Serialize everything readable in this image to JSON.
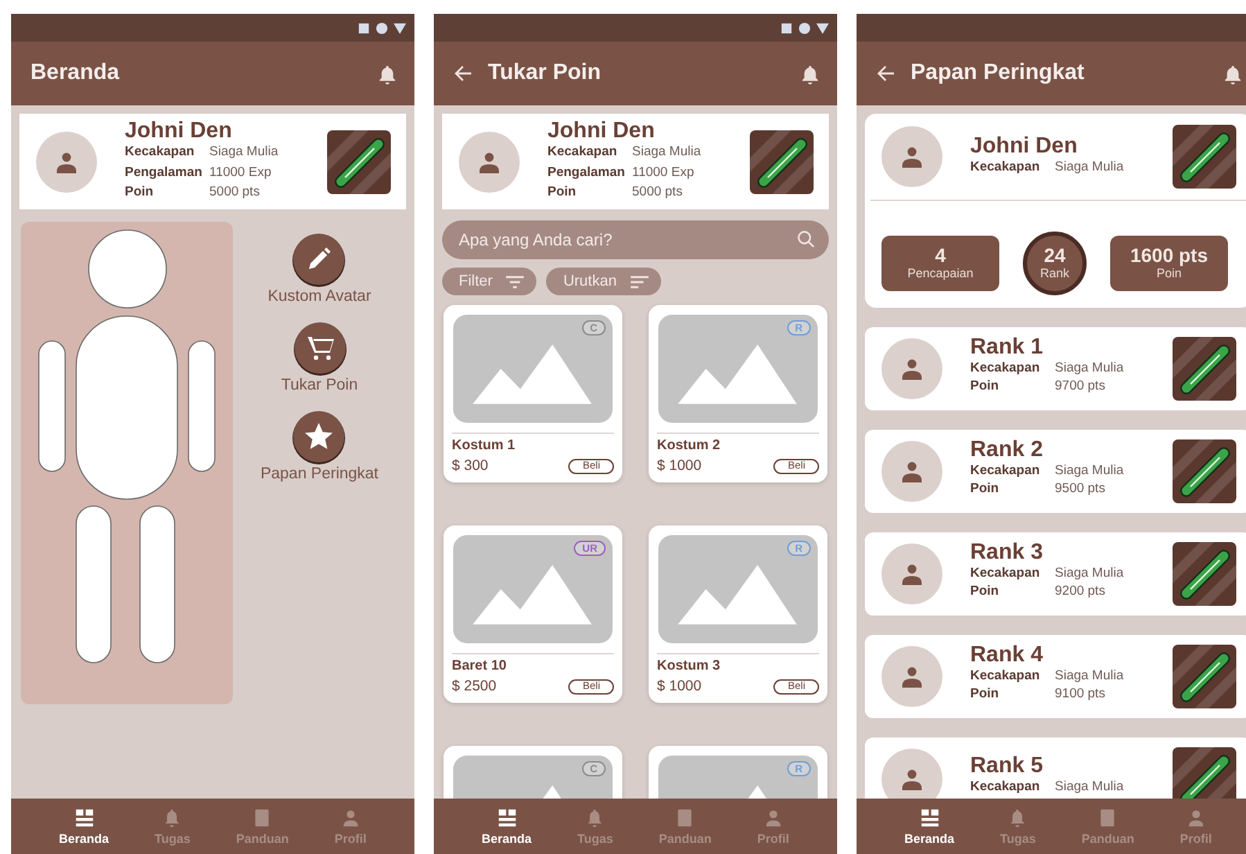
{
  "screens": [
    {
      "kind": "home",
      "status_icons": true,
      "back": false,
      "title": "Beranda",
      "profile": {
        "name": "Johni Den",
        "stats": [
          {
            "label": "Kecakapan",
            "value": "Siaga Mulia"
          },
          {
            "label": "Pengalaman",
            "value": "11000 Exp"
          },
          {
            "label": "Poin",
            "value": "5000 pts"
          }
        ]
      },
      "menu": [
        {
          "kind": "edit",
          "label": "Kustom Avatar"
        },
        {
          "kind": "cart",
          "label": "Tukar Poin"
        },
        {
          "kind": "star",
          "label": "Papan Peringkat"
        }
      ],
      "nav": [
        {
          "kind": "home",
          "label": "Beranda",
          "selected": true
        },
        {
          "kind": "tasks",
          "label": "Tugas",
          "selected": false
        },
        {
          "kind": "guide",
          "label": "Panduan",
          "selected": false
        },
        {
          "kind": "profile",
          "label": "Profil",
          "selected": false
        }
      ]
    },
    {
      "kind": "shop",
      "status_icons": true,
      "back": true,
      "title": "Tukar Poin",
      "profile": {
        "name": "Johni Den",
        "stats": [
          {
            "label": "Kecakapan",
            "value": "Siaga Mulia"
          },
          {
            "label": "Pengalaman",
            "value": "11000 Exp"
          },
          {
            "label": "Poin",
            "value": "5000 pts"
          }
        ]
      },
      "search": {
        "placeholder": "Apa yang Anda cari?"
      },
      "chips": [
        {
          "kind": "filter",
          "label": "Filter"
        },
        {
          "kind": "sort",
          "label": "Urutkan"
        }
      ],
      "items": [
        {
          "rarity": "C",
          "color": "#8c8c8c",
          "name": "Kostum 1",
          "price": "$ 300",
          "button": "Beli"
        },
        {
          "rarity": "R",
          "color": "#6f9fd8",
          "name": "Kostum 2",
          "price": "$ 1000",
          "button": "Beli"
        },
        {
          "rarity": "UR",
          "color": "#a05fc0",
          "name": "Baret 10",
          "price": "$ 2500",
          "button": "Beli"
        },
        {
          "rarity": "R",
          "color": "#6f9fd8",
          "name": "Kostum 3",
          "price": "$ 1000",
          "button": "Beli"
        },
        {
          "rarity": "C",
          "color": "#8c8c8c"
        },
        {
          "rarity": "R",
          "color": "#6f9fd8"
        }
      ],
      "nav": [
        {
          "kind": "home",
          "label": "Beranda",
          "selected": true
        },
        {
          "kind": "tasks",
          "label": "Tugas",
          "selected": false
        },
        {
          "kind": "guide",
          "label": "Panduan",
          "selected": false
        },
        {
          "kind": "profile",
          "label": "Profil",
          "selected": false
        }
      ]
    },
    {
      "kind": "leaderboard",
      "status_icons": false,
      "back": true,
      "title": "Papan Peringkat",
      "profile": {
        "name": "Johni Den",
        "stats": [
          {
            "label": "Kecakapan",
            "value": "Siaga Mulia"
          }
        ]
      },
      "summary": [
        {
          "kind": "box",
          "value": "4",
          "label": "Pencapaian"
        },
        {
          "kind": "circle",
          "value": "24",
          "label": "Rank"
        },
        {
          "kind": "box",
          "value": "1600 pts",
          "label": "Poin"
        }
      ],
      "ranks": [
        {
          "name": "Rank 1",
          "stats": [
            {
              "label": "Kecakapan",
              "value": "Siaga Mulia"
            },
            {
              "label": "Poin",
              "value": "9700 pts"
            }
          ]
        },
        {
          "name": "Rank 2",
          "stats": [
            {
              "label": "Kecakapan",
              "value": "Siaga Mulia"
            },
            {
              "label": "Poin",
              "value": "9500 pts"
            }
          ]
        },
        {
          "name": "Rank 3",
          "stats": [
            {
              "label": "Kecakapan",
              "value": "Siaga Mulia"
            },
            {
              "label": "Poin",
              "value": "9200 pts"
            }
          ]
        },
        {
          "name": "Rank 4",
          "stats": [
            {
              "label": "Kecakapan",
              "value": "Siaga Mulia"
            },
            {
              "label": "Poin",
              "value": "9100 pts"
            }
          ]
        },
        {
          "name": "Rank 5",
          "stats": [
            {
              "label": "Kecakapan",
              "value": "Siaga Mulia"
            }
          ]
        }
      ],
      "nav": [
        {
          "kind": "home",
          "label": "Beranda",
          "selected": true
        },
        {
          "kind": "tasks",
          "label": "Tugas",
          "selected": false
        },
        {
          "kind": "guide",
          "label": "Panduan",
          "selected": false
        },
        {
          "kind": "profile",
          "label": "Profil",
          "selected": false
        }
      ]
    }
  ]
}
